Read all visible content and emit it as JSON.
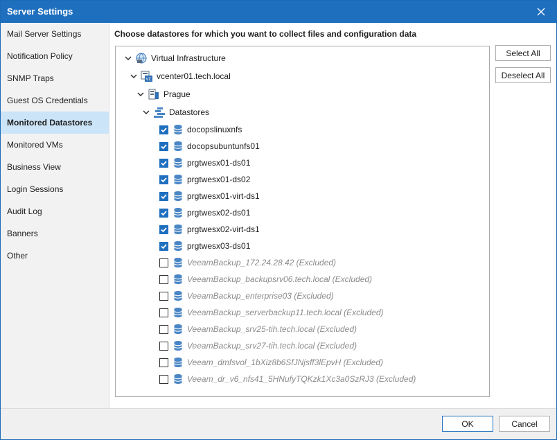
{
  "window": {
    "title": "Server Settings"
  },
  "sidebar": {
    "items": [
      {
        "label": "Mail Server Settings"
      },
      {
        "label": "Notification Policy"
      },
      {
        "label": "SNMP Traps"
      },
      {
        "label": "Guest OS Credentials"
      },
      {
        "label": "Monitored Datastores",
        "selected": true
      },
      {
        "label": "Monitored VMs"
      },
      {
        "label": "Business View"
      },
      {
        "label": "Login Sessions"
      },
      {
        "label": "Audit Log"
      },
      {
        "label": "Banners"
      },
      {
        "label": "Other"
      }
    ]
  },
  "main": {
    "heading": "Choose datastores for which you want to collect files and configuration data",
    "select_all_label": "Select All",
    "deselect_all_label": "Deselect All"
  },
  "tree": {
    "root": {
      "label": "Virtual Infrastructure",
      "icon": "virtual-infrastructure-icon"
    },
    "vcenter": {
      "label": "vcenter01.tech.local",
      "icon": "vcenter-icon"
    },
    "datacenter": {
      "label": "Prague",
      "icon": "datacenter-icon"
    },
    "folder": {
      "label": "Datastores",
      "icon": "datastores-folder-icon"
    },
    "datastores": [
      {
        "label": "docopslinuxnfs",
        "checked": true,
        "excluded": false
      },
      {
        "label": "docopsubuntunfs01",
        "checked": true,
        "excluded": false
      },
      {
        "label": "prgtwesx01-ds01",
        "checked": true,
        "excluded": false
      },
      {
        "label": "prgtwesx01-ds02",
        "checked": true,
        "excluded": false
      },
      {
        "label": "prgtwesx01-virt-ds1",
        "checked": true,
        "excluded": false
      },
      {
        "label": "prgtwesx02-ds01",
        "checked": true,
        "excluded": false
      },
      {
        "label": "prgtwesx02-virt-ds1",
        "checked": true,
        "excluded": false
      },
      {
        "label": "prgtwesx03-ds01",
        "checked": true,
        "excluded": false
      },
      {
        "label": "VeeamBackup_172.24.28.42 (Excluded)",
        "checked": false,
        "excluded": true
      },
      {
        "label": "VeeamBackup_backupsrv06.tech.local (Excluded)",
        "checked": false,
        "excluded": true
      },
      {
        "label": "VeeamBackup_enterprise03 (Excluded)",
        "checked": false,
        "excluded": true
      },
      {
        "label": "VeeamBackup_serverbackup11.tech.local (Excluded)",
        "checked": false,
        "excluded": true
      },
      {
        "label": "VeeamBackup_srv25-tih.tech.local (Excluded)",
        "checked": false,
        "excluded": true
      },
      {
        "label": "VeeamBackup_srv27-tih.tech.local (Excluded)",
        "checked": false,
        "excluded": true
      },
      {
        "label": "Veeam_dmfsvol_1bXiz8b6SfJNjsff3lEpvH (Excluded)",
        "checked": false,
        "excluded": true
      },
      {
        "label": "Veeam_dr_v6_nfs41_5HNufyTQKzk1Xc3a0SzRJ3 (Excluded)",
        "checked": false,
        "excluded": true
      }
    ]
  },
  "footer": {
    "ok_label": "OK",
    "cancel_label": "Cancel"
  },
  "colors": {
    "accent": "#1f6fbf",
    "selected_nav": "#cce4f7",
    "excluded_text": "#8c8c8c",
    "database_icon": "#4a86c5"
  }
}
